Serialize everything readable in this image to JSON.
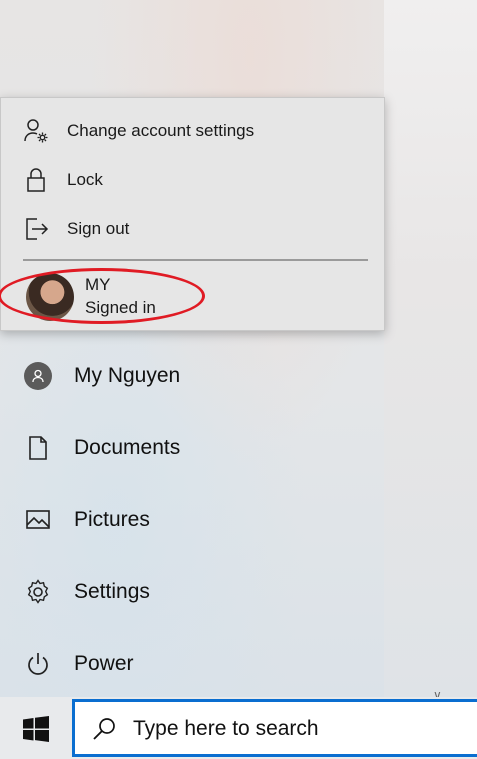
{
  "flyout": {
    "items": [
      {
        "label": "Change account settings",
        "icon": "account-settings-icon"
      },
      {
        "label": "Lock",
        "icon": "lock-icon"
      },
      {
        "label": "Sign out",
        "icon": "sign-out-icon"
      }
    ],
    "account": {
      "name": "MY",
      "status": "Signed in"
    }
  },
  "start_menu": {
    "items": [
      {
        "label": "My Nguyen",
        "icon": "user-icon"
      },
      {
        "label": "Documents",
        "icon": "document-icon"
      },
      {
        "label": "Pictures",
        "icon": "pictures-icon"
      },
      {
        "label": "Settings",
        "icon": "gear-icon"
      },
      {
        "label": "Power",
        "icon": "power-icon"
      }
    ]
  },
  "taskbar": {
    "search_placeholder": "Type here to search"
  },
  "colors": {
    "highlight_ring": "#e01b24",
    "search_border": "#0a6ed0"
  }
}
